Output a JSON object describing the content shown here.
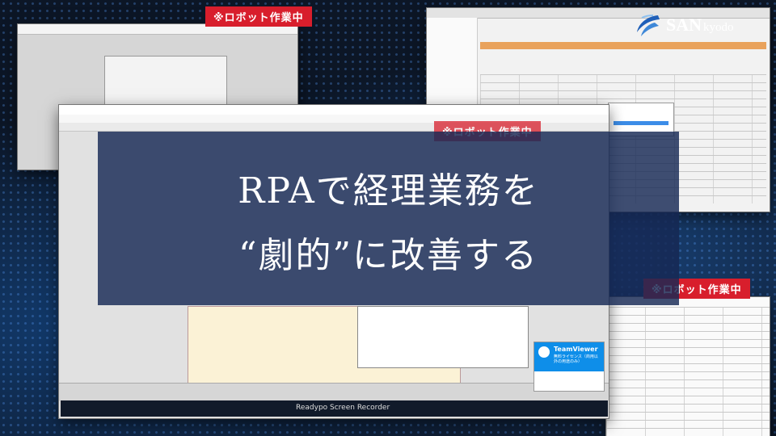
{
  "hero": {
    "line1": "RPAで経理業務を",
    "line2": "“劇的”に改善する"
  },
  "badges": {
    "robot_working": "※ロボット作業中"
  },
  "logo": {
    "san": "SAN",
    "kyodo": "kyodo"
  },
  "teamviewer": {
    "title": "TeamViewer",
    "subtitle": "無料ライセンス（商用以外の用途のみ）"
  },
  "recorder": {
    "label": "Readypo Screen Recorder"
  },
  "colors": {
    "accent_red": "#d81e2c",
    "overlay_navy": "#162854",
    "teamviewer_blue": "#0e8ee9"
  },
  "icons": {
    "logo_mark": "swoosh-logo-icon",
    "teamviewer": "teamviewer-icon"
  }
}
